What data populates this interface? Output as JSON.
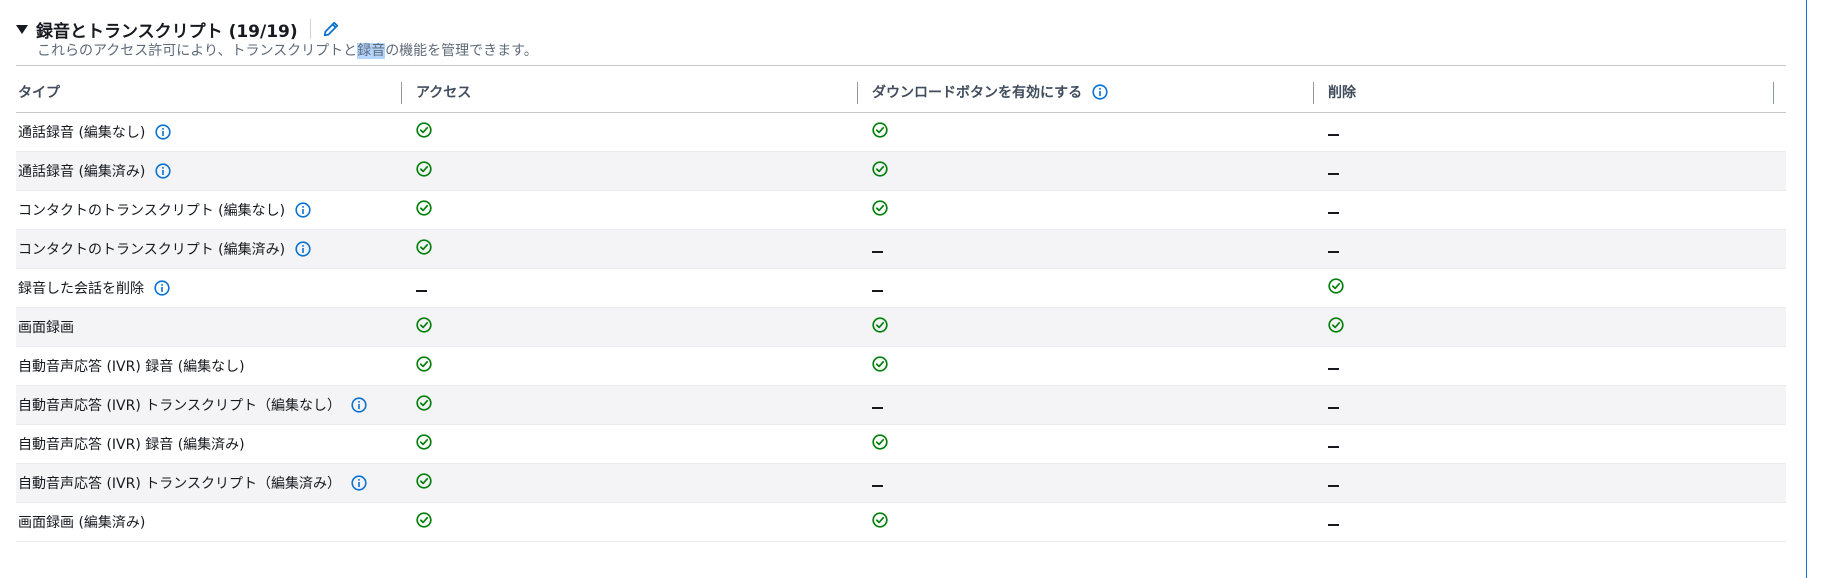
{
  "section": {
    "title": "録音とトランスクリプト (19/19)",
    "description_before": "これらのアクセス許可により、トランスクリプトと",
    "description_highlight": "録音",
    "description_after": "の機能を管理できます。"
  },
  "table": {
    "headers": {
      "type": "タイプ",
      "access": "アクセス",
      "download": "ダウンロードボタンを有効にする",
      "delete": "削除"
    },
    "rows": [
      {
        "type": "通話録音 (編集なし)",
        "info": true,
        "access": "check",
        "download": "check",
        "delete": "dash"
      },
      {
        "type": "通話録音 (編集済み)",
        "info": true,
        "access": "check",
        "download": "check",
        "delete": "dash"
      },
      {
        "type": "コンタクトのトランスクリプト (編集なし)",
        "info": true,
        "access": "check",
        "download": "check",
        "delete": "dash"
      },
      {
        "type": "コンタクトのトランスクリプト (編集済み)",
        "info": true,
        "access": "check",
        "download": "dash",
        "delete": "dash"
      },
      {
        "type": "録音した会話を削除",
        "info": true,
        "access": "dash",
        "download": "dash",
        "delete": "check"
      },
      {
        "type": "画面録画",
        "info": false,
        "access": "check",
        "download": "check",
        "delete": "check"
      },
      {
        "type": "自動音声応答 (IVR) 録音 (編集なし)",
        "info": false,
        "access": "check",
        "download": "check",
        "delete": "dash"
      },
      {
        "type": "自動音声応答 (IVR) トランスクリプト（編集なし）",
        "info": true,
        "access": "check",
        "download": "dash",
        "delete": "dash"
      },
      {
        "type": "自動音声応答 (IVR) 録音 (編集済み)",
        "info": false,
        "access": "check",
        "download": "check",
        "delete": "dash"
      },
      {
        "type": "自動音声応答 (IVR) トランスクリプト（編集済み）",
        "info": true,
        "access": "check",
        "download": "dash",
        "delete": "dash"
      },
      {
        "type": "画面録画 (編集済み)",
        "info": false,
        "access": "check",
        "download": "check",
        "delete": "dash"
      }
    ]
  },
  "icons": {
    "check": "status-positive-icon",
    "dash": "dash-icon",
    "info": "info-icon",
    "edit": "pencil-icon",
    "caret": "caret-down-icon"
  },
  "colors": {
    "positive": "#037f0c",
    "info": "#0972d3",
    "header_text": "#414d5c",
    "alt_row": "#f4f4f6"
  }
}
